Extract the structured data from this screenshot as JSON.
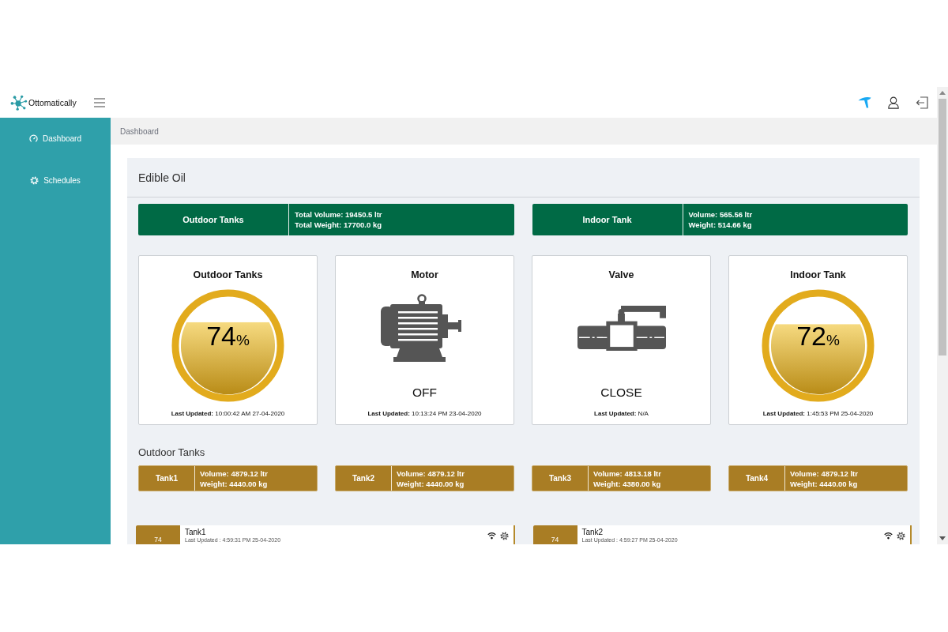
{
  "header": {
    "brand": "Ottomatically"
  },
  "sidebar": {
    "items": [
      {
        "label": "Dashboard"
      },
      {
        "label": "Schedules"
      }
    ]
  },
  "breadcrumb": "Dashboard",
  "panel": {
    "title": "Edible Oil",
    "summaries": [
      {
        "label": "Outdoor Tanks",
        "lines": [
          "Total Volume: 19450.5 ltr",
          "Total Weight: 17700.0 kg"
        ]
      },
      {
        "label": "Indoor Tank",
        "lines": [
          "Volume: 565.56 ltr",
          "Weight: 514.66 kg"
        ]
      }
    ],
    "cards": [
      {
        "kind": "tank",
        "title": "Outdoor Tanks",
        "level": 0.74,
        "reading": "74",
        "unit": "%",
        "updated": "**Last Updated:** 10:00:42 AM 27-04-2020"
      },
      {
        "kind": "motor",
        "title": "Motor",
        "status": "OFF",
        "updated": "**Last Updated:** 10:13:24 PM 23-04-2020"
      },
      {
        "kind": "valve",
        "title": "Valve",
        "status": "CLOSE",
        "updated": "**Last Updated:** N/A"
      },
      {
        "kind": "tank",
        "title": "Indoor Tank",
        "level": 0.72,
        "reading": "72",
        "unit": "%",
        "updated": "**Last Updated:** 1:45:53 PM 25-04-2020"
      }
    ],
    "section_title": "Outdoor Tanks",
    "tanks": [
      {
        "name": "Tank1",
        "lines": [
          "Volume: 4879.12 ltr",
          "Weight: 4440.00 kg"
        ]
      },
      {
        "name": "Tank2",
        "lines": [
          "Volume: 4879.12 ltr",
          "Weight: 4440.00 kg"
        ]
      },
      {
        "name": "Tank3",
        "lines": [
          "Volume: 4813.18 ltr",
          "Weight: 4380.00 kg"
        ]
      },
      {
        "name": "Tank4",
        "lines": [
          "Volume: 4879.12 ltr",
          "Weight: 4440.00 kg"
        ]
      }
    ],
    "tank_rows": [
      {
        "reading": "74",
        "name": "Tank1",
        "updated": "Last Updated : 4:59:31 PM 25-04-2020"
      },
      {
        "reading": "74",
        "name": "Tank2",
        "updated": "Last Updated : 4:59:27 PM 25-04-2020"
      }
    ]
  }
}
